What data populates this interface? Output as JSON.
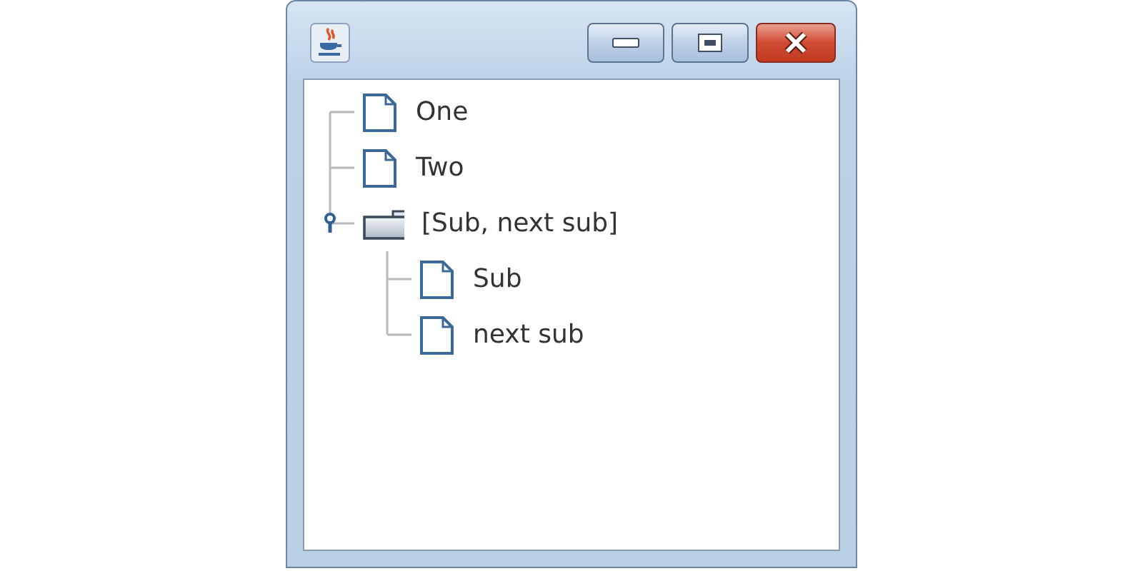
{
  "tree": {
    "items": [
      {
        "label": "One",
        "kind": "leaf"
      },
      {
        "label": "Two",
        "kind": "leaf"
      },
      {
        "label": "[Sub, next sub]",
        "kind": "folder",
        "expanded": true,
        "children": [
          {
            "label": "Sub",
            "kind": "leaf"
          },
          {
            "label": "next sub",
            "kind": "leaf"
          }
        ]
      }
    ]
  }
}
